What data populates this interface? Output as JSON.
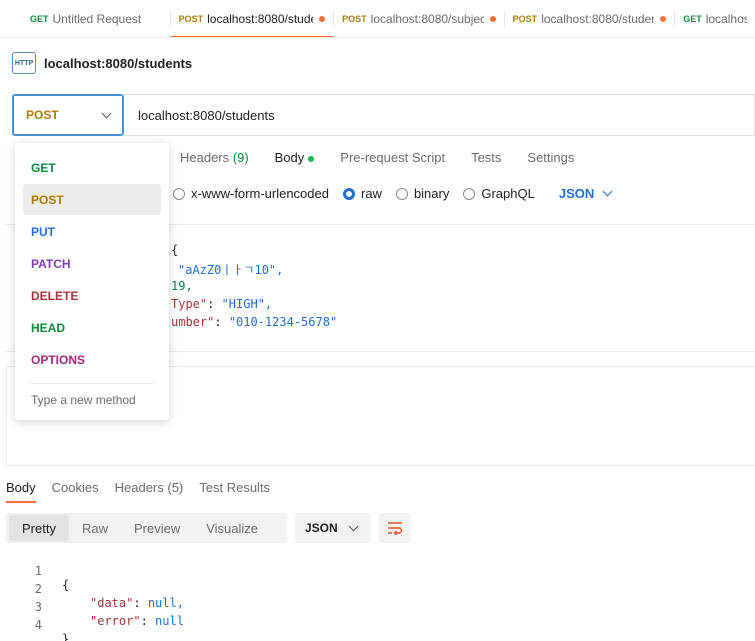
{
  "tabs": [
    {
      "method": "GET",
      "method_color": "#0e8a3b",
      "title": "Untitled Request",
      "unsaved": false,
      "active": false
    },
    {
      "method": "POST",
      "method_color": "#ad7a03",
      "title": "localhost:8080/studen",
      "unsaved": true,
      "active": true
    },
    {
      "method": "POST",
      "method_color": "#ad7a03",
      "title": "localhost:8080/subjec",
      "unsaved": true,
      "active": false
    },
    {
      "method": "POST",
      "method_color": "#ad7a03",
      "title": "localhost:8080/studen",
      "unsaved": true,
      "active": false
    },
    {
      "method": "GET",
      "method_color": "#0e8a3b",
      "title": "localhos",
      "unsaved": false,
      "active": false
    }
  ],
  "request": {
    "icon_label": "HTTP",
    "name": "localhost:8080/students",
    "method": "POST",
    "url": "localhost:8080/students"
  },
  "req_tabs": {
    "headers": "Headers",
    "headers_count": "(9)",
    "body": "Body",
    "prerequest": "Pre-request Script",
    "tests": "Tests",
    "settings": "Settings"
  },
  "body_types": {
    "urlencoded": "x-www-form-urlencoded",
    "raw": "raw",
    "binary": "binary",
    "graphql": "GraphQL",
    "format": "JSON"
  },
  "editor_lines": [
    {
      "t1": "{",
      "t2": "",
      "t3": ""
    },
    {
      "t1": "\"aAzZ0ㅣㅏㄱ10\",",
      "t2": "",
      "t3": ""
    },
    {
      "t1": "19,",
      "t2": "",
      "t3": ""
    },
    {
      "t1": "Type\"",
      "t2": ": ",
      "t3": "\"HIGH\","
    },
    {
      "t1": "umber\"",
      "t2": ": ",
      "t3": "\"010-1234-5678\""
    }
  ],
  "methods_dropdown": {
    "items": [
      {
        "label": "GET",
        "color": "#0e8a3b",
        "selected": false
      },
      {
        "label": "POST",
        "color": "#ad7a03",
        "selected": true
      },
      {
        "label": "PUT",
        "color": "#1f6ed4",
        "selected": false
      },
      {
        "label": "PATCH",
        "color": "#7a3fb8",
        "selected": false
      },
      {
        "label": "DELETE",
        "color": "#a2353d",
        "selected": false
      },
      {
        "label": "HEAD",
        "color": "#0e8a3b",
        "selected": false
      },
      {
        "label": "OPTIONS",
        "color": "#a5277a",
        "selected": false
      }
    ],
    "new_method_placeholder": "Type a new method"
  },
  "response": {
    "tabs": {
      "body": "Body",
      "cookies": "Cookies",
      "headers": "Headers (5)",
      "test_results": "Test Results"
    },
    "views": {
      "pretty": "Pretty",
      "raw": "Raw",
      "preview": "Preview",
      "visualize": "Visualize"
    },
    "format": "JSON",
    "lines": [
      {
        "num": "1",
        "text": "{"
      },
      {
        "num": "2",
        "key": "\"data\"",
        "sep": ": ",
        "val": "null,"
      },
      {
        "num": "3",
        "key": "\"error\"",
        "sep": ": ",
        "val": "null"
      },
      {
        "num": "4",
        "text": "}"
      }
    ]
  }
}
